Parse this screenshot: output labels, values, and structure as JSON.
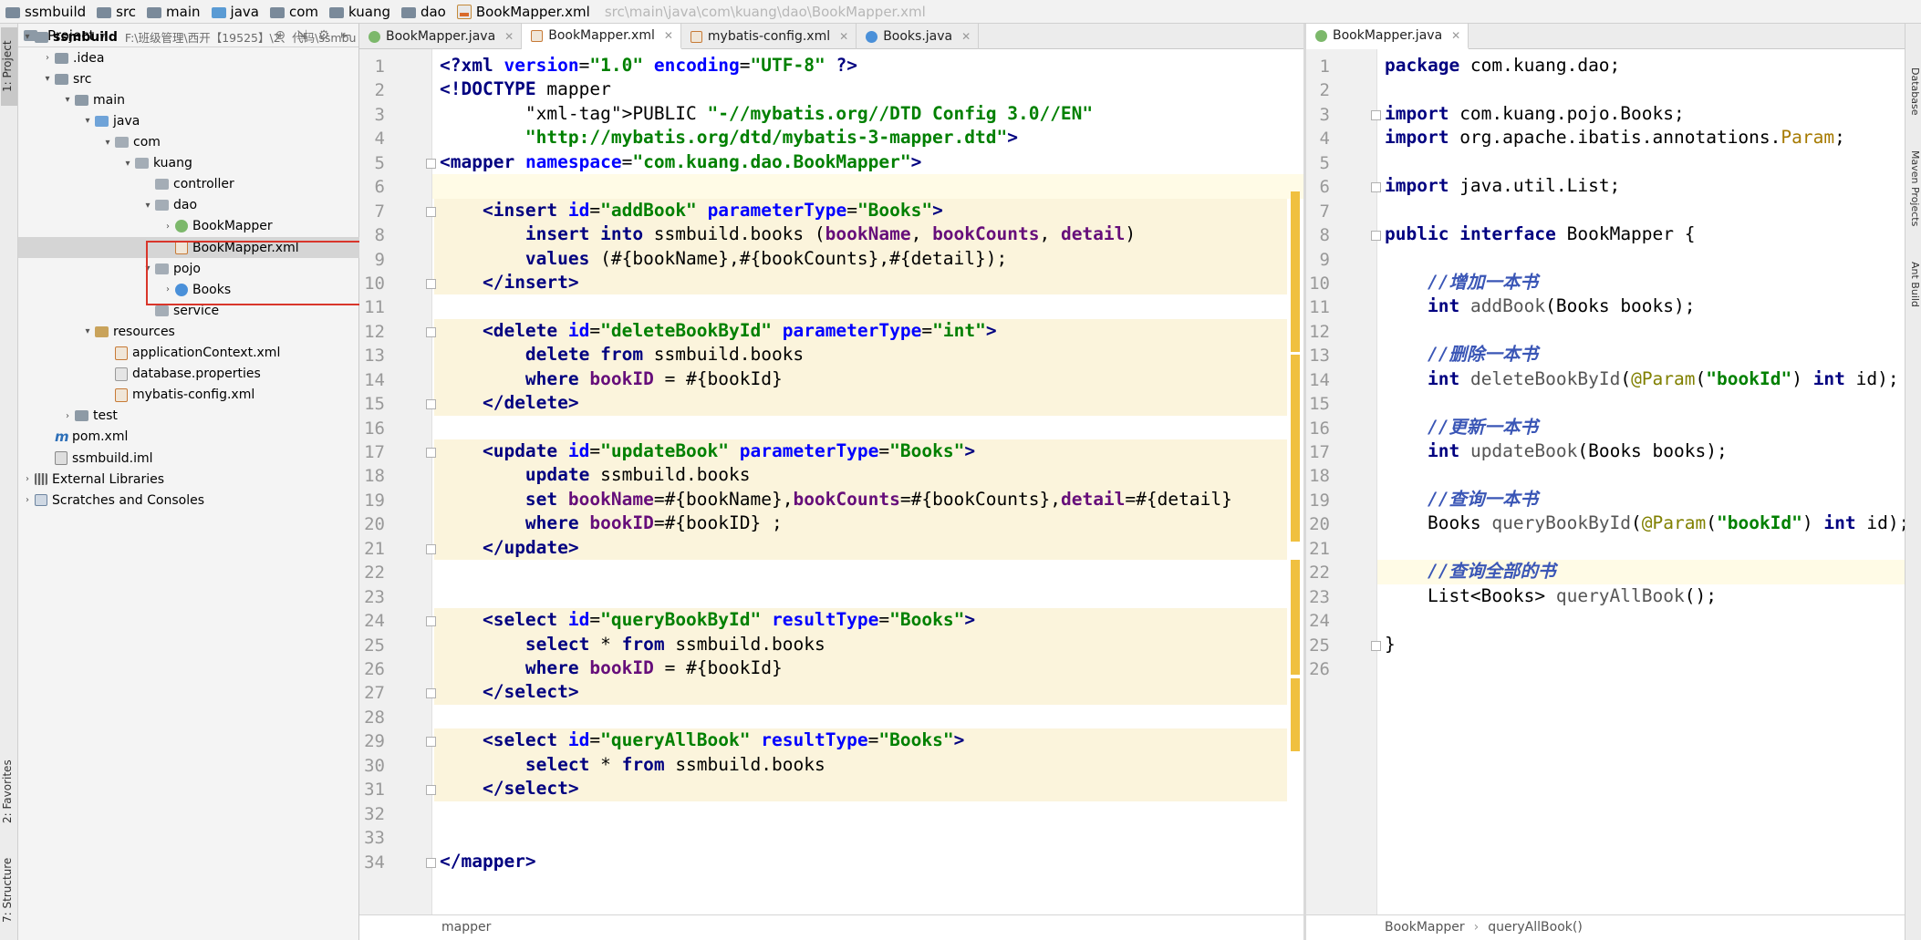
{
  "breadcrumb": [
    {
      "label": "ssmbuild",
      "icon": "folder-icon"
    },
    {
      "label": "src",
      "icon": "folder-icon"
    },
    {
      "label": "main",
      "icon": "folder-icon"
    },
    {
      "label": "java",
      "icon": "folder-icon"
    },
    {
      "label": "com",
      "icon": "folder-icon"
    },
    {
      "label": "kuang",
      "icon": "folder-icon"
    },
    {
      "label": "dao",
      "icon": "folder-icon"
    },
    {
      "label": "BookMapper.xml",
      "icon": "xml-file-icon"
    }
  ],
  "breadcrumb_overlay": "src\\main\\java\\com\\kuang\\dao\\BookMapper.xml",
  "left_tool_tabs": {
    "project": "1: Project",
    "favorites": "2: Favorites",
    "structure": "7: Structure"
  },
  "right_tool_tabs": {
    "database": "Database",
    "maven": "Maven Projects",
    "ant": "Ant Build"
  },
  "project_panel": {
    "title": "Project",
    "dropdown": "▾",
    "tree": [
      {
        "label": "ssmbuild",
        "path": "F:\\班级管理\\西开【19525】\\2、代码\\ssmbu",
        "depth": 0,
        "arrow": "▾",
        "icon": "folder",
        "bold": true
      },
      {
        "label": ".idea",
        "depth": 1,
        "arrow": "›",
        "icon": "folder"
      },
      {
        "label": "src",
        "depth": 1,
        "arrow": "▾",
        "icon": "folder"
      },
      {
        "label": "main",
        "depth": 2,
        "arrow": "▾",
        "icon": "folder"
      },
      {
        "label": "java",
        "depth": 3,
        "arrow": "▾",
        "icon": "src"
      },
      {
        "label": "com",
        "depth": 4,
        "arrow": "▾",
        "icon": "pkg"
      },
      {
        "label": "kuang",
        "depth": 5,
        "arrow": "▾",
        "icon": "pkg"
      },
      {
        "label": "controller",
        "depth": 6,
        "arrow": "",
        "icon": "pkg"
      },
      {
        "label": "dao",
        "depth": 6,
        "arrow": "▾",
        "icon": "pkg"
      },
      {
        "label": "BookMapper",
        "depth": 7,
        "arrow": "›",
        "icon": "iface"
      },
      {
        "label": "BookMapper.xml",
        "depth": 7,
        "arrow": "",
        "icon": "xml",
        "selected": true
      },
      {
        "label": "pojo",
        "depth": 6,
        "arrow": "▾",
        "icon": "pkg"
      },
      {
        "label": "Books",
        "depth": 7,
        "arrow": "›",
        "icon": "cls"
      },
      {
        "label": "service",
        "depth": 6,
        "arrow": "",
        "icon": "pkg"
      },
      {
        "label": "resources",
        "depth": 3,
        "arrow": "▾",
        "icon": "res"
      },
      {
        "label": "applicationContext.xml",
        "depth": 4,
        "arrow": "",
        "icon": "xml"
      },
      {
        "label": "database.properties",
        "depth": 4,
        "arrow": "",
        "icon": "props"
      },
      {
        "label": "mybatis-config.xml",
        "depth": 4,
        "arrow": "",
        "icon": "xml"
      },
      {
        "label": "test",
        "depth": 2,
        "arrow": "›",
        "icon": "folder"
      },
      {
        "label": "pom.xml",
        "depth": 1,
        "arrow": "",
        "icon": "m"
      },
      {
        "label": "ssmbuild.iml",
        "depth": 1,
        "arrow": "",
        "icon": "iml"
      },
      {
        "label": "External Libraries",
        "depth": 0,
        "arrow": "›",
        "icon": "lib"
      },
      {
        "label": "Scratches and Consoles",
        "depth": 0,
        "arrow": "›",
        "icon": "scratch"
      }
    ]
  },
  "editor_left": {
    "tabs": [
      {
        "label": "BookMapper.java",
        "icon": "i",
        "active": false
      },
      {
        "label": "BookMapper.xml",
        "icon": "x",
        "active": true
      },
      {
        "label": "mybatis-config.xml",
        "icon": "x",
        "active": false
      },
      {
        "label": "Books.java",
        "icon": "c",
        "active": false
      }
    ],
    "status_breadcrumb": "mapper",
    "line_numbers": [
      "1",
      "2",
      "3",
      "4",
      "5",
      "6",
      "7",
      "8",
      "9",
      "10",
      "11",
      "12",
      "13",
      "14",
      "15",
      "16",
      "17",
      "18",
      "19",
      "20",
      "21",
      "22",
      "23",
      "24",
      "25",
      "26",
      "27",
      "28",
      "29",
      "30",
      "31",
      "32",
      "33",
      "34"
    ],
    "lines": [
      "<?xml version=\"1.0\" encoding=\"UTF-8\" ?>",
      "<!DOCTYPE mapper",
      "        PUBLIC \"-//mybatis.org//DTD Config 3.0//EN\"",
      "        \"http://mybatis.org/dtd/mybatis-3-mapper.dtd\">",
      "<mapper namespace=\"com.kuang.dao.BookMapper\">",
      "",
      "    <insert id=\"addBook\" parameterType=\"Books\">",
      "        insert into ssmbuild.books (bookName, bookCounts, detail)",
      "        values (#{bookName},#{bookCounts},#{detail});",
      "    </insert>",
      "",
      "    <delete id=\"deleteBookById\" parameterType=\"int\">",
      "        delete from ssmbuild.books",
      "        where bookID = #{bookId}",
      "    </delete>",
      "",
      "    <update id=\"updateBook\" parameterType=\"Books\">",
      "        update ssmbuild.books",
      "        set bookName=#{bookName},bookCounts=#{bookCounts},detail=#{detail}",
      "        where bookID=#{bookID} ;",
      "    </update>",
      "",
      "",
      "    <select id=\"queryBookById\" resultType=\"Books\">",
      "        select * from ssmbuild.books",
      "        where bookID = #{bookId}",
      "    </select>",
      "",
      "    <select id=\"queryAllBook\" resultType=\"Books\">",
      "        select * from ssmbuild.books",
      "    </select>",
      "",
      "",
      "</mapper>"
    ]
  },
  "editor_right": {
    "tabs": [
      {
        "label": "BookMapper.java",
        "icon": "i",
        "active": true
      }
    ],
    "status_breadcrumb": [
      "BookMapper",
      "queryAllBook()"
    ],
    "line_numbers": [
      "1",
      "2",
      "3",
      "4",
      "5",
      "6",
      "7",
      "8",
      "9",
      "10",
      "11",
      "12",
      "13",
      "14",
      "15",
      "16",
      "17",
      "18",
      "19",
      "20",
      "21",
      "22",
      "23",
      "24",
      "25",
      "26"
    ],
    "lines": [
      "package com.kuang.dao;",
      "",
      "import com.kuang.pojo.Books;",
      "import org.apache.ibatis.annotations.Param;",
      "",
      "import java.util.List;",
      "",
      "public interface BookMapper {",
      "",
      "    //增加一本书",
      "    int addBook(Books books);",
      "",
      "    //删除一本书",
      "    int deleteBookById(@Param(\"bookId\") int id);",
      "",
      "    //更新一本书",
      "    int updateBook(Books books);",
      "",
      "    //查询一本书",
      "    Books queryBookById(@Param(\"bookId\") int id);",
      "",
      "    //查询全部的书",
      "    List<Books> queryAllBook();",
      "",
      "}",
      ""
    ]
  },
  "colors": {
    "highlight": "#fbf4dc",
    "selection_box": "#d9362b",
    "xml_tag": "#000080",
    "xml_value": "#008000"
  }
}
